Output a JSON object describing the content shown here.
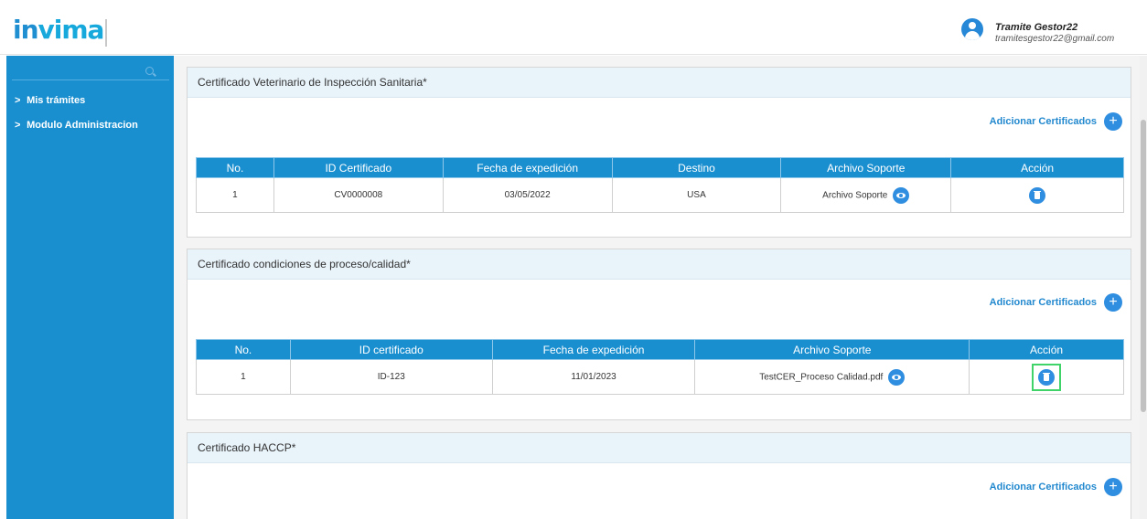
{
  "header": {
    "logo_part1": "in",
    "logo_part2": "vima",
    "user_name": "Tramite Gestor22",
    "user_email": "tramitesgestor22@gmail.com"
  },
  "sidebar": {
    "items": [
      {
        "label": "Mis trámites"
      },
      {
        "label": "Modulo Administracion"
      }
    ]
  },
  "sections": [
    {
      "title": "Certificado Veterinario de Inspección Sanitaria*",
      "add_label": "Adicionar Certificados",
      "columns": [
        "No.",
        "ID Certificado",
        "Fecha de expedición",
        "Destino",
        "Archivo Soporte",
        "Acción"
      ],
      "rows": [
        {
          "no": "1",
          "id": "CV0000008",
          "fecha": "03/05/2022",
          "destino": "USA",
          "archivo": "Archivo Soporte"
        }
      ]
    },
    {
      "title": "Certificado condiciones de proceso/calidad*",
      "add_label": "Adicionar Certificados",
      "columns": [
        "No.",
        "ID certificado",
        "Fecha de expedición",
        "Archivo Soporte",
        "Acción"
      ],
      "rows": [
        {
          "no": "1",
          "id": "ID-123",
          "fecha": "11/01/2023",
          "archivo": "TestCER_Proceso Calidad.pdf"
        }
      ]
    },
    {
      "title": "Certificado HACCP*",
      "add_label": "Adicionar Certificados"
    }
  ],
  "colors": {
    "primary": "#1a8fd0",
    "accent_button": "#2f8ee0",
    "highlight": "#3fd36a"
  },
  "icons": [
    "user-avatar-icon",
    "search-icon",
    "chevron-right-icon",
    "plus-icon",
    "eye-icon",
    "trash-icon"
  ]
}
